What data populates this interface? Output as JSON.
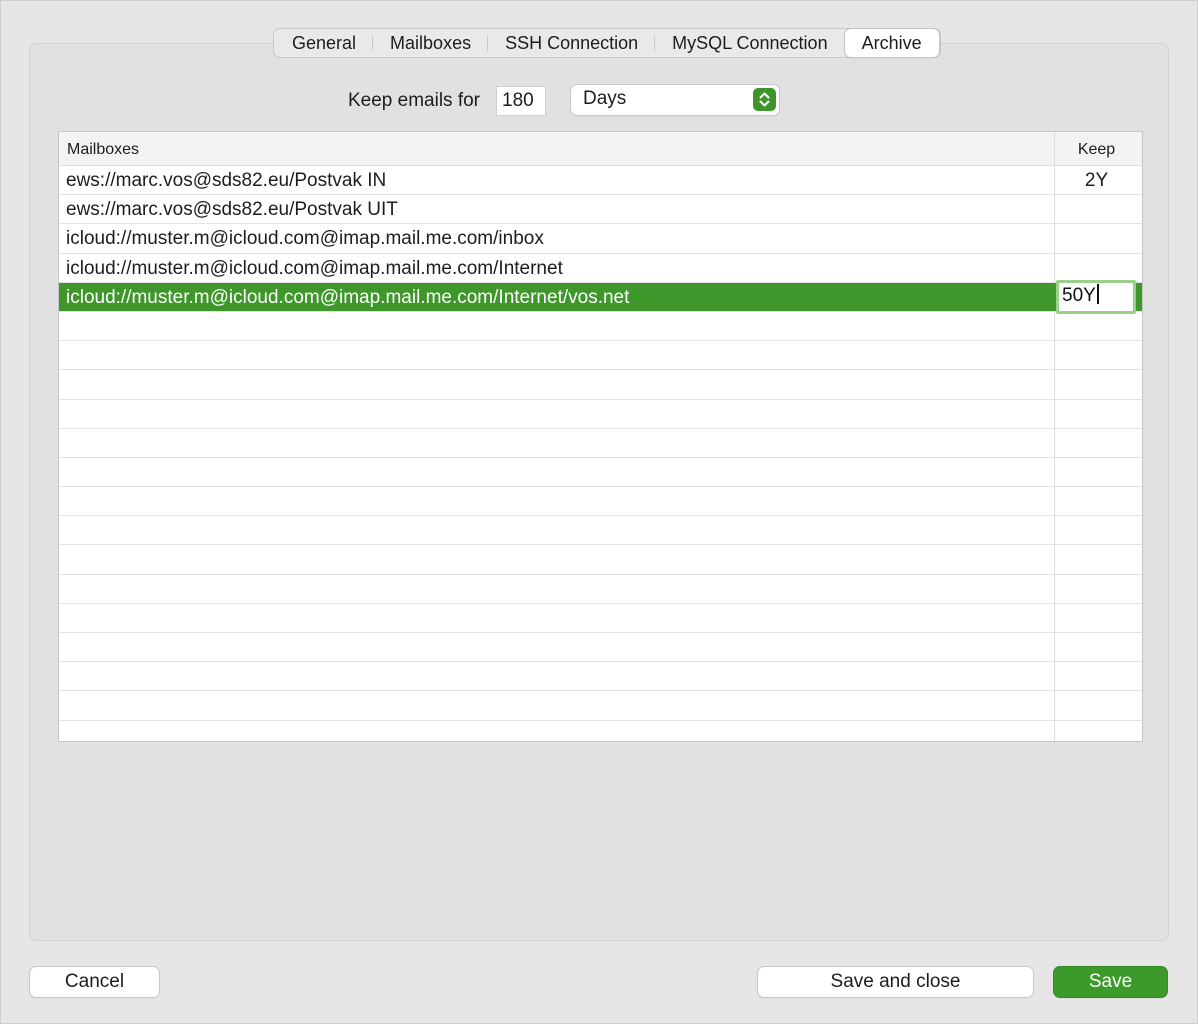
{
  "tabs": [
    {
      "label": "General",
      "active": false
    },
    {
      "label": "Mailboxes",
      "active": false
    },
    {
      "label": "SSH Connection",
      "active": false
    },
    {
      "label": "MySQL Connection",
      "active": false
    },
    {
      "label": "Archive",
      "active": true
    }
  ],
  "retention": {
    "label": "Keep emails for",
    "value": "180",
    "unit": "Days"
  },
  "table": {
    "headers": {
      "mailboxes": "Mailboxes",
      "keep": "Keep"
    },
    "rows": [
      {
        "mailbox": "ews://marc.vos@sds82.eu/Postvak IN",
        "keep": "2Y"
      },
      {
        "mailbox": "ews://marc.vos@sds82.eu/Postvak UIT",
        "keep": ""
      },
      {
        "mailbox": "icloud://muster.m@icloud.com@imap.mail.me.com/inbox",
        "keep": ""
      },
      {
        "mailbox": "icloud://muster.m@icloud.com@imap.mail.me.com/Internet",
        "keep": ""
      },
      {
        "mailbox": "icloud://muster.m@icloud.com@imap.mail.me.com/Internet/vos.net",
        "keep": "50Y",
        "selected": true,
        "editing": true
      }
    ],
    "empty_rows": 14
  },
  "buttons": {
    "cancel": "Cancel",
    "save_close": "Save and close",
    "save": "Save"
  },
  "colors": {
    "accent": "#3e962a",
    "selection": "#3f962b"
  }
}
